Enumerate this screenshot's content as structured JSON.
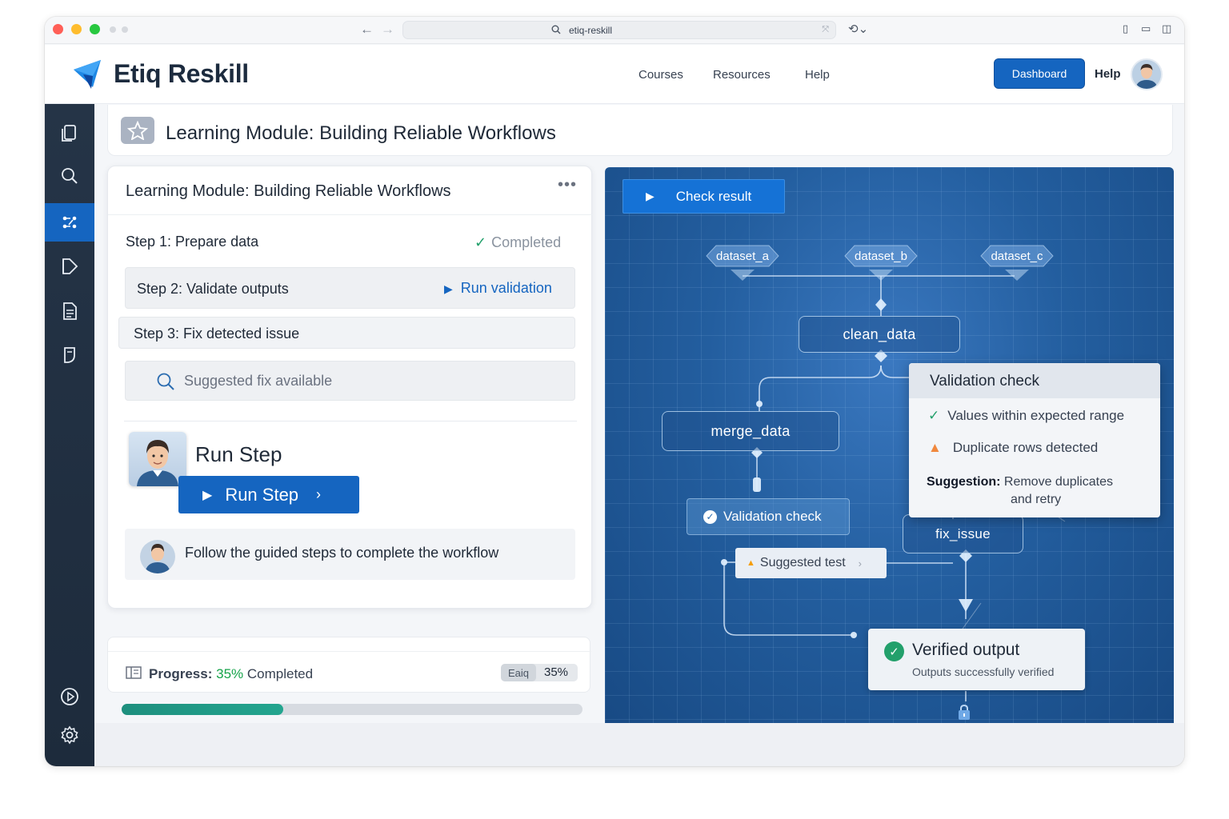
{
  "browser": {
    "url": "etiq-reskill"
  },
  "app": {
    "brand": "Etiq Reskill",
    "nav": [
      "Courses",
      "Resources",
      "Help"
    ],
    "dashboard_label": "Dashboard",
    "help_label": "Help"
  },
  "sidebar": {
    "items": [
      "documents-icon",
      "search-icon",
      "workflow-icon",
      "play-doc-icon",
      "file-text-icon",
      "bookmark-icon",
      "play-circle-icon",
      "gear-icon"
    ],
    "active_index": 2
  },
  "page": {
    "title": "Learning Module: Building Reliable Workflows"
  },
  "module": {
    "title": "Learning Module: Building Reliable Workflows",
    "step1": {
      "label": "Step 1: Prepare data",
      "status": "Completed"
    },
    "step2": {
      "label": "Step 2: Validate outputs",
      "action": "Run validation"
    },
    "step3": {
      "label": "Step 3: Fix detected issue"
    },
    "suggested_fix": "Suggested fix available",
    "run_step_heading": "Run Step",
    "run_step_button": "Run Step",
    "guide_text": "Follow the guided steps to complete the workflow"
  },
  "progress": {
    "label": "Progress:",
    "percent_text": "35%",
    "suffix": "Completed",
    "badge_name": "Eaiq",
    "badge_percent": "35%",
    "fraction": 0.35
  },
  "diagram": {
    "check_result": "Check result",
    "datasets": [
      "dataset_a",
      "dataset_b",
      "dataset_c"
    ],
    "nodes": {
      "clean": "clean_data",
      "merge": "merge_data",
      "validation": "Validation check",
      "fix": "fix_issue",
      "suggested_test": "Suggested test"
    },
    "popup": {
      "title": "Validation check",
      "ok_item": "Values within expected range",
      "warn_item": "Duplicate rows detected",
      "suggestion_label": "Suggestion",
      "suggestion_text_1": "Remove duplicates",
      "suggestion_text_2": "and retry"
    },
    "verified": {
      "title": "Verified output",
      "subtitle": "Outputs successfully verified"
    }
  },
  "colors": {
    "accent": "#1565c0",
    "success": "#22a06b",
    "warning": "#f0883e",
    "sidebar": "#1d2b3c",
    "progress": "#1e8f7e"
  }
}
